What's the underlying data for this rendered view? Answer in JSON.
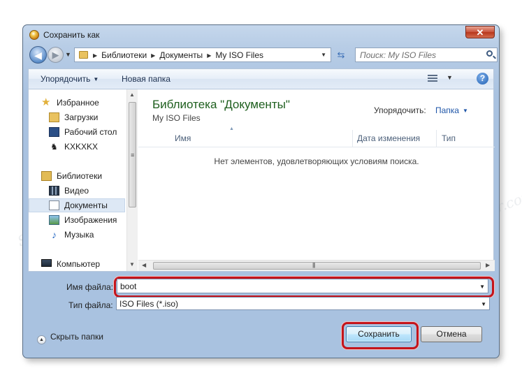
{
  "window": {
    "title": "Сохранить как",
    "close_label": "✕"
  },
  "nav": {
    "breadcrumbs": [
      "Библиотеки",
      "Документы",
      "My ISO Files"
    ],
    "search_placeholder": "Поиск: My ISO Files"
  },
  "toolbar": {
    "organize": "Упорядочить",
    "new_folder": "Новая папка",
    "help": "?"
  },
  "sidebar": {
    "favorites": "Избранное",
    "favorites_items": [
      "Загрузки",
      "Рабочий стол",
      "KXKXKX"
    ],
    "libraries": "Библиотеки",
    "libraries_items": [
      "Видео",
      "Документы",
      "Изображения",
      "Музыка"
    ],
    "computer": "Компьютер",
    "selected": "Документы"
  },
  "content": {
    "library_title": "Библиотека \"Документы\"",
    "library_subtitle": "My ISO Files",
    "arrange_label": "Упорядочить:",
    "arrange_value": "Папка",
    "columns": [
      "Имя",
      "Дата изменения",
      "Тип"
    ],
    "empty_message": "Нет элементов, удовлетворяющих условиям поиска."
  },
  "form": {
    "filename_label": "Имя файла:",
    "filename_value": "boot",
    "filetype_label": "Тип файла:",
    "filetype_value": "ISO Files (*.iso)"
  },
  "footer": {
    "hide_folders": "Скрыть папки",
    "save": "Сохранить",
    "cancel": "Отмена"
  },
  "watermark": "Soringpcrepair.com",
  "colors": {
    "highlight": "#c4141b",
    "library_title": "#1e5f1e",
    "arrange_link": "#1f56a8"
  },
  "icons": [
    "app-icon",
    "back-arrow-icon",
    "forward-arrow-icon",
    "folder-icon",
    "refresh-icon",
    "search-icon",
    "view-icon",
    "help-icon",
    "star-icon",
    "downloads-icon",
    "desktop-icon",
    "user-icon",
    "libraries-icon",
    "video-icon",
    "documents-icon",
    "images-icon",
    "music-icon",
    "computer-icon"
  ]
}
